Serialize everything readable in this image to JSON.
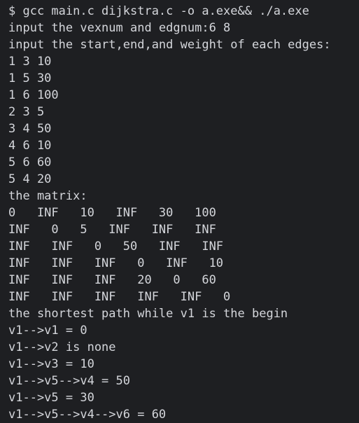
{
  "terminal": {
    "lines": [
      "$ gcc main.c dijkstra.c -o a.exe&& ./a.exe",
      "input the vexnum and edgnum:6 8",
      "input the start,end,and weight of each edges:",
      "1 3 10",
      "1 5 30",
      "1 6 100",
      "2 3 5",
      "3 4 50",
      "4 6 10",
      "5 6 60",
      "5 4 20",
      "the matrix:",
      "0   INF   10   INF   30   100",
      "INF   0   5   INF   INF   INF",
      "INF   INF   0   50   INF   INF",
      "INF   INF   INF   0   INF   10",
      "INF   INF   INF   20   0   60",
      "INF   INF   INF   INF   INF   0",
      "the shortest path while v1 is the begin",
      "v1-->v1 = 0",
      "v1-->v2 is none",
      "v1-->v3 = 10",
      "v1-->v5-->v4 = 50",
      "v1-->v5 = 30",
      "v1-->v5-->v4-->v6 = 60"
    ]
  }
}
